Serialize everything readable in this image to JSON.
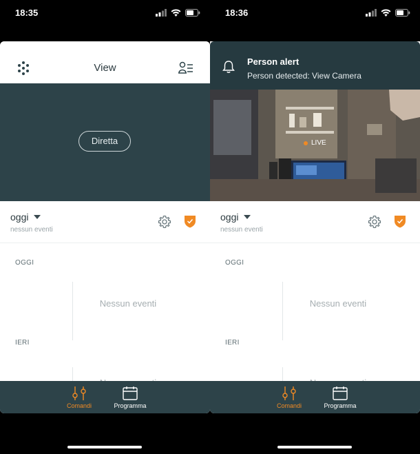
{
  "colors": {
    "accent": "#f08a24",
    "dark_teal": "#2d4349",
    "notif_bg": "#263a40",
    "muted": "#a6aeb1"
  },
  "left": {
    "status": {
      "time": "18:35"
    },
    "header": {
      "title": "View",
      "menu_icon": "grid-dots-icon",
      "users_icon": "user-list-icon"
    },
    "live_button": "Diretta",
    "day": {
      "label": "oggi",
      "sub": "nessun eventi"
    },
    "timeline": [
      {
        "day": "OGGI",
        "empty": "Nessun eventi"
      },
      {
        "day": "IERI",
        "empty": "Nessun eventi"
      }
    ],
    "tabs": [
      {
        "label": "Comandi",
        "icon": "sliders-icon",
        "active": true
      },
      {
        "label": "Programma",
        "icon": "calendar-icon",
        "active": false
      }
    ]
  },
  "right": {
    "status": {
      "time": "18:36"
    },
    "notification": {
      "title": "Person alert",
      "body": "Person detected: View Camera",
      "icon": "bell-icon"
    },
    "live_badge": "LIVE",
    "day": {
      "label": "oggi",
      "sub": "nessun eventi"
    },
    "timeline": [
      {
        "day": "OGGI",
        "empty": "Nessun eventi"
      },
      {
        "day": "IERI",
        "empty": "Nessun eventi"
      }
    ],
    "tabs": [
      {
        "label": "Comandi",
        "icon": "sliders-icon",
        "active": true
      },
      {
        "label": "Programma",
        "icon": "calendar-icon",
        "active": false
      }
    ]
  }
}
